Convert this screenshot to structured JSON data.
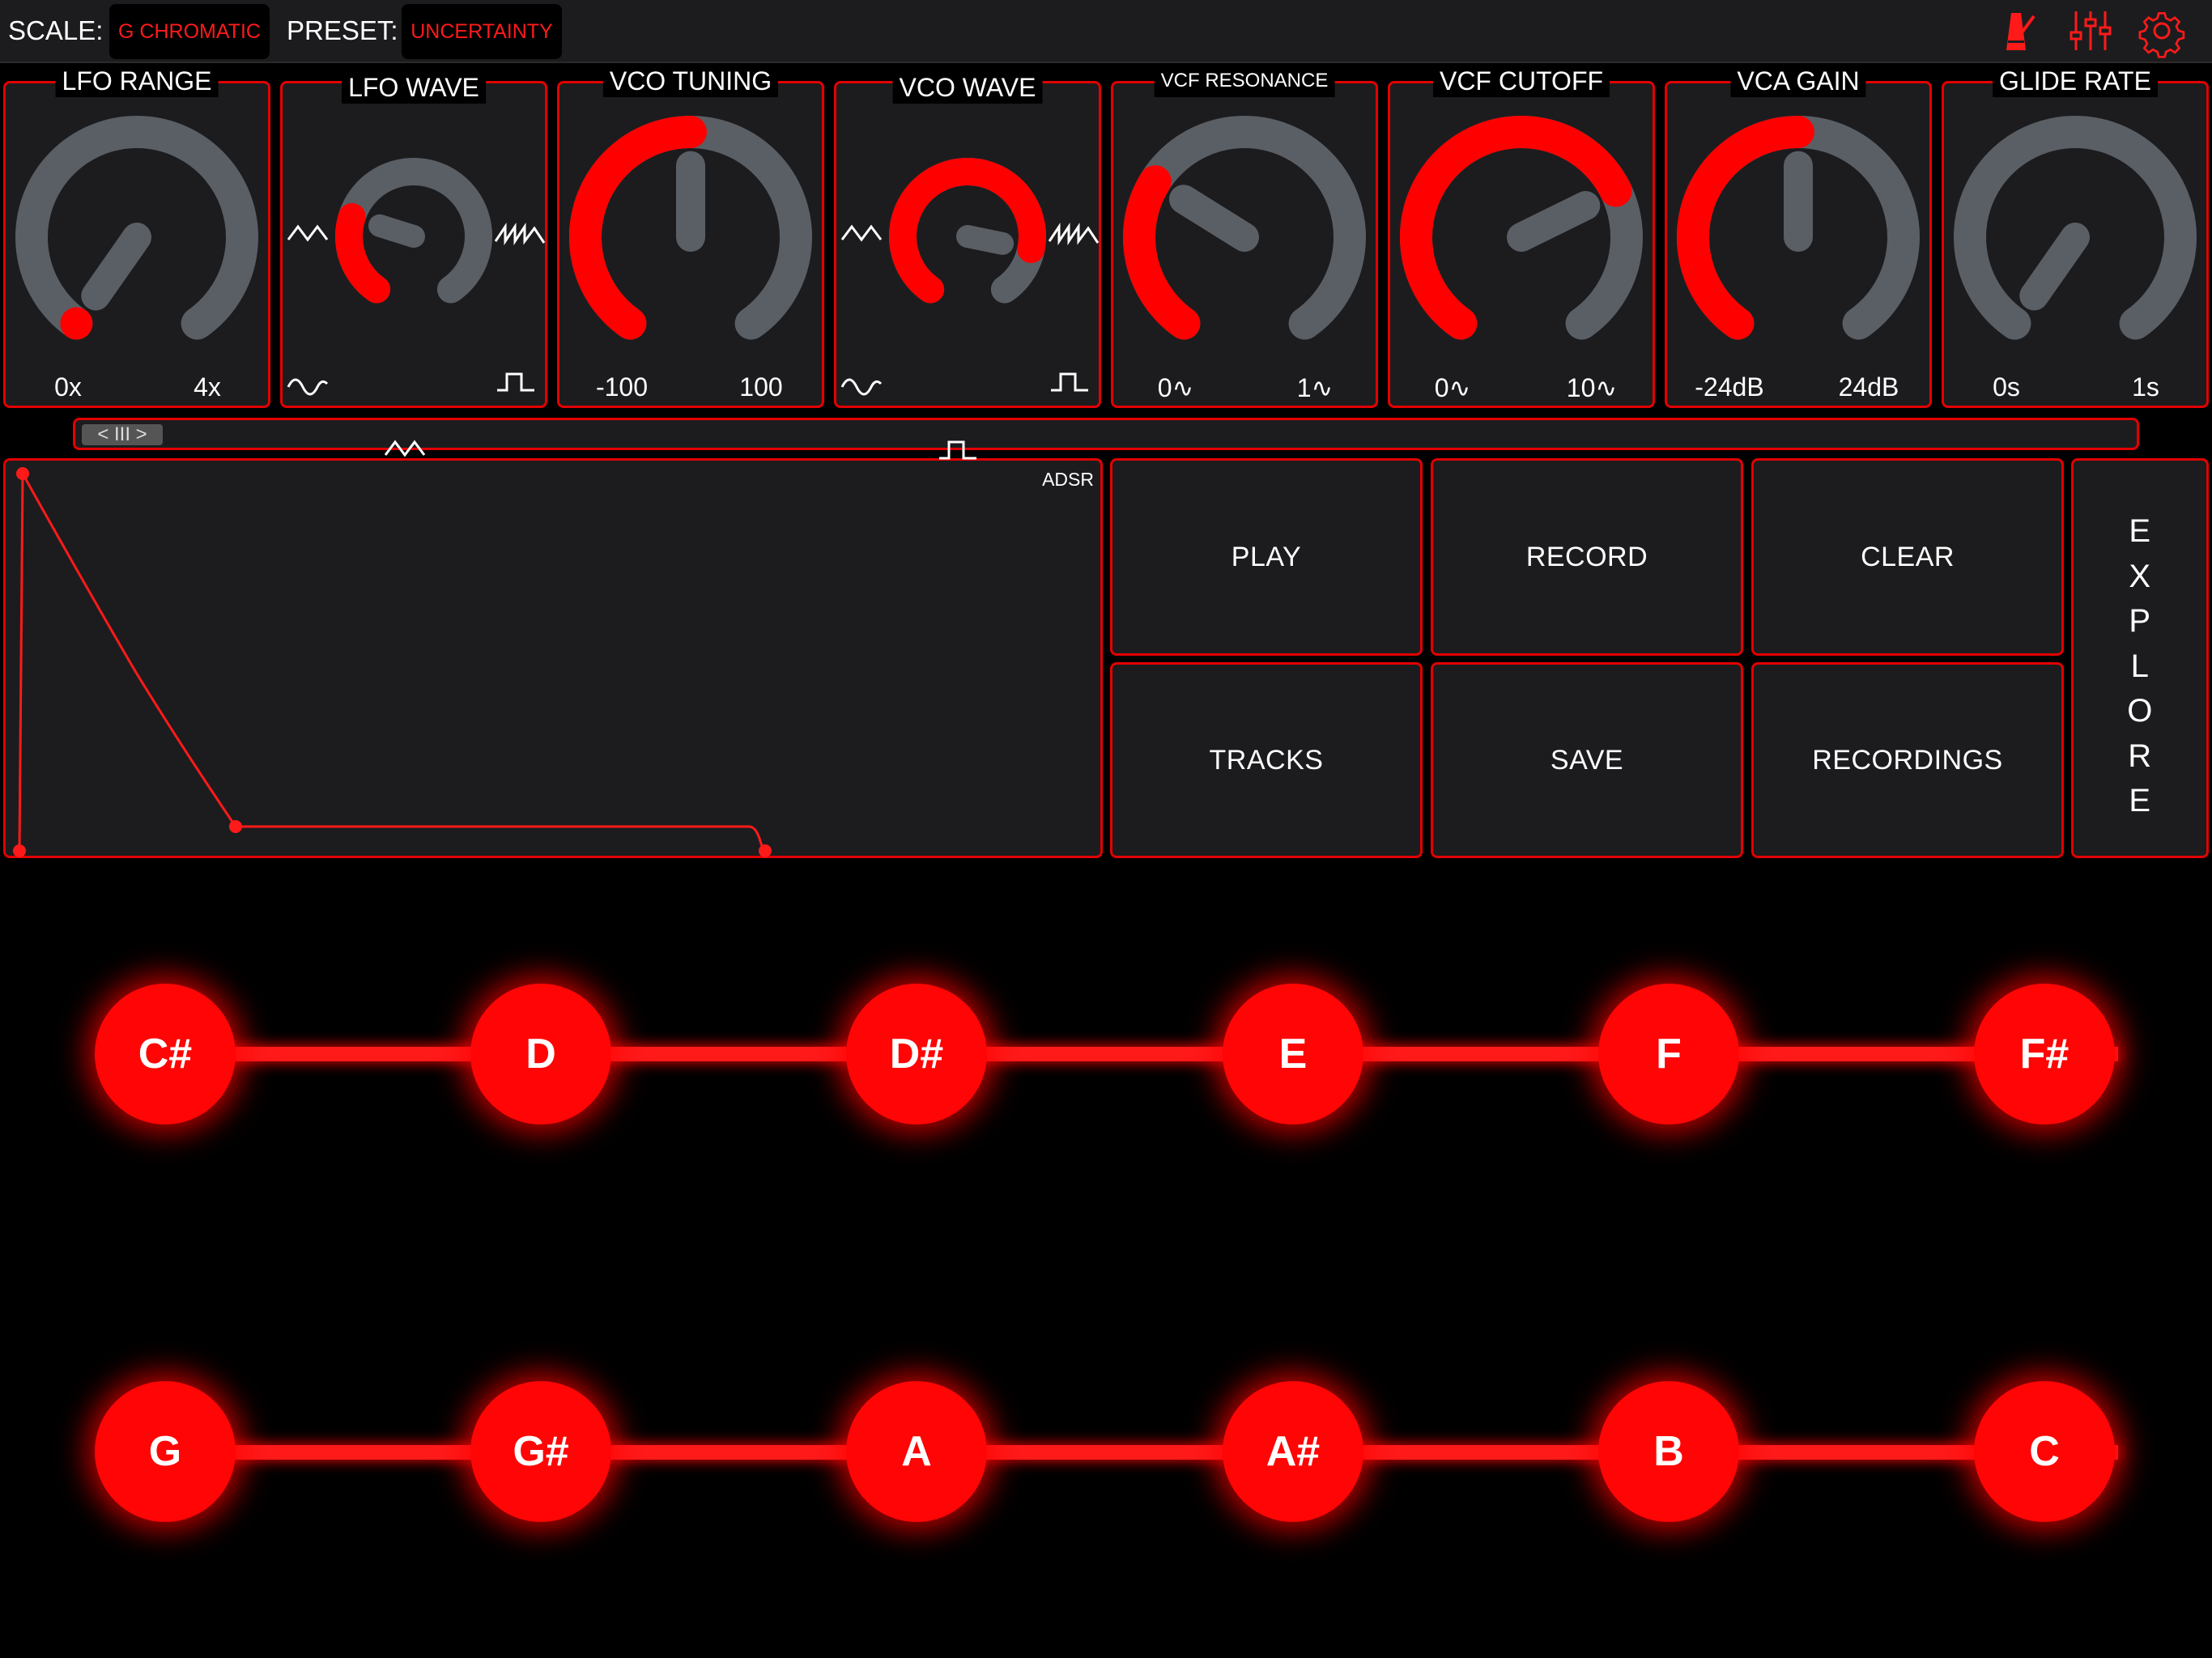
{
  "topbar": {
    "scale_label": "SCALE:",
    "scale_value": "G CHROMATIC",
    "preset_label": "PRESET:",
    "preset_value": "UNCERTAINTY",
    "icons": [
      "metronome-icon",
      "mixer-sliders-icon",
      "gear-icon"
    ]
  },
  "panels": [
    {
      "title": "LFO RANGE",
      "min": "0x",
      "max": "4x",
      "level": 0.0
    },
    {
      "title": "LFO WAVE",
      "wave_icons": [
        "triangle-wave-icon",
        "sawtooth-wave-icon",
        "sine-wave-icon",
        "square-wave-icon",
        "triangle-wave-icon"
      ],
      "level": 0.25
    },
    {
      "title": "VCO TUNING",
      "min": "-100",
      "max": "100",
      "level": 0.5
    },
    {
      "title": "VCO WAVE",
      "wave_icons": [
        "triangle-wave-icon",
        "sawtooth-wave-icon",
        "sine-wave-icon",
        "square-wave-icon",
        "square-wave-icon"
      ],
      "level": 0.85
    },
    {
      "title": "VCF RESONANCE",
      "min": "0∿",
      "max": "1∿",
      "level": 0.3
    },
    {
      "title": "VCF CUTOFF",
      "min": "0∿",
      "max": "10∿",
      "level": 0.72
    },
    {
      "title": "VCA GAIN",
      "min": "-24dB",
      "max": "24dB",
      "level": 0.5
    },
    {
      "title": "GLIDE RATE",
      "min": "0s",
      "max": "1s",
      "level": 0.0
    }
  ],
  "scroll": {
    "thumb_label": "< III >"
  },
  "adsr": {
    "label": "ADSR"
  },
  "buttons": {
    "play": "PLAY",
    "record": "RECORD",
    "clear": "CLEAR",
    "tracks": "TRACKS",
    "save": "SAVE",
    "recordings": "RECORDINGS",
    "explore": "EXPLORE"
  },
  "keys": {
    "row1": [
      "C#",
      "D",
      "D#",
      "E",
      "F",
      "F#"
    ],
    "row2": [
      "G",
      "G#",
      "A",
      "A#",
      "B",
      "C"
    ]
  },
  "colors": {
    "accent": "#ff0000",
    "panel": "#1c1c1e",
    "track": "#5a5f66"
  }
}
